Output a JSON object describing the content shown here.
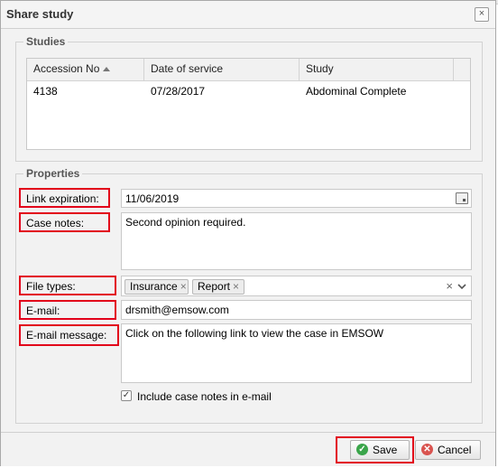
{
  "dialog": {
    "title": "Share study",
    "close_symbol": "×"
  },
  "studies": {
    "legend": "Studies",
    "columns": [
      "Accession No",
      "Date of service",
      "Study"
    ],
    "rows": [
      [
        "4138",
        "07/28/2017",
        "Abdominal Complete"
      ]
    ]
  },
  "properties": {
    "legend": "Properties",
    "link_expiration": {
      "label": "Link expiration:",
      "value": "11/06/2019"
    },
    "case_notes": {
      "label": "Case notes:",
      "value": "Second opinion required."
    },
    "file_types": {
      "label": "File types:",
      "tags": [
        "Insurance",
        "Report"
      ],
      "clear_symbol": "×"
    },
    "email": {
      "label": "E-mail:",
      "value": "drsmith@emsow.com"
    },
    "email_message": {
      "label": "E-mail message:",
      "value": "Click on the following link to view the case in EMSOW"
    },
    "include_notes": {
      "label": "Include case notes in e-mail",
      "checked": true
    }
  },
  "footer": {
    "save_label": "Save",
    "cancel_label": "Cancel"
  },
  "colors": {
    "highlight": "#e2001a",
    "save_icon": "#3aa54a",
    "cancel_icon": "#d9534f"
  }
}
